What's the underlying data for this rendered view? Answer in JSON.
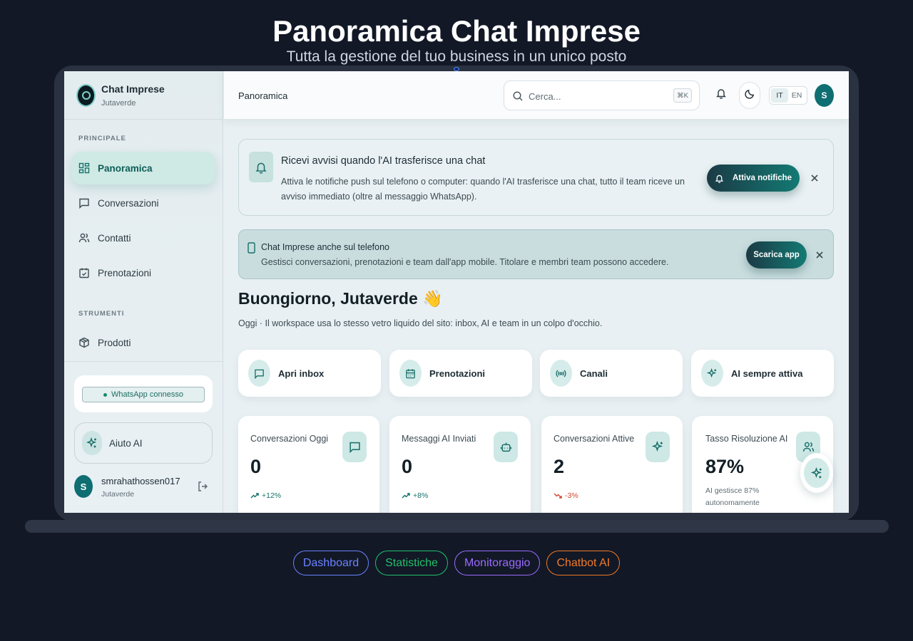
{
  "hero": {
    "title": "Panoramica Chat Imprese",
    "subtitle": "Tutta la gestione del tuo business in un unico posto"
  },
  "brand": {
    "name": "Chat Imprese",
    "workspace": "Jutaverde"
  },
  "sidebar": {
    "section_main": "PRINCIPALE",
    "section_tools": "STRUMENTI",
    "items": [
      {
        "label": "Panoramica",
        "icon": "grid-icon",
        "active": true
      },
      {
        "label": "Conversazioni",
        "icon": "chat-icon"
      },
      {
        "label": "Contatti",
        "icon": "users-icon"
      },
      {
        "label": "Prenotazioni",
        "icon": "calendar-check-icon"
      }
    ],
    "tools": [
      {
        "label": "Prodotti",
        "icon": "package-icon"
      }
    ],
    "whatsapp_status": "WhatsApp connesso",
    "help_label": "Aiuto AI",
    "user": {
      "name": "smrahathossen017",
      "workspace": "Jutaverde",
      "initial": "S"
    }
  },
  "topbar": {
    "breadcrumb": "Panoramica",
    "search_placeholder": "Cerca...",
    "shortcut": "⌘K",
    "lang": [
      "IT",
      "EN"
    ],
    "lang_active": "IT",
    "avatar_initial": "S"
  },
  "notice": {
    "title": "Ricevi avvisi quando l'AI trasferisce una chat",
    "desc": "Attiva le notifiche push sul telefono o computer: quando l'AI trasferisce una chat, tutto il team riceve un avviso immediato (oltre al messaggio WhatsApp).",
    "button": "Attiva notifiche"
  },
  "app_banner": {
    "title": "Chat Imprese anche sul telefono",
    "desc": "Gestisci conversazioni, prenotazioni e team dall'app mobile. Titolare e membri team possono accedere.",
    "button": "Scarica app"
  },
  "greeting": {
    "title": "Buongiorno, Jutaverde 👋",
    "subtitle": "Oggi · Il workspace usa lo stesso vetro liquido del sito: inbox, AI e team in un colpo d'occhio."
  },
  "quick_actions": [
    {
      "label": "Apri inbox",
      "icon": "chat-icon"
    },
    {
      "label": "Prenotazioni",
      "icon": "calendar-icon"
    },
    {
      "label": "Canali",
      "icon": "broadcast-icon"
    },
    {
      "label": "AI sempre attiva",
      "icon": "sparkles-icon"
    }
  ],
  "stats": [
    {
      "label": "Conversazioni Oggi",
      "value": "0",
      "trend": "+12%",
      "direction": "up",
      "icon": "chat-icon"
    },
    {
      "label": "Messaggi AI Inviati",
      "value": "0",
      "trend": "+8%",
      "direction": "up",
      "icon": "bot-icon"
    },
    {
      "label": "Conversazioni Attive",
      "value": "2",
      "trend": "-3%",
      "direction": "down",
      "icon": "sparkles-icon"
    },
    {
      "label": "Tasso Risoluzione AI",
      "value": "87%",
      "note": "AI gestisce 87% autonomamente",
      "icon": "users-icon"
    }
  ],
  "colors": {
    "accent": "#137269",
    "trend_up": "#137269",
    "trend_down": "#d2452b"
  },
  "tabs": [
    {
      "label": "Dashboard",
      "color": "#6b82ff"
    },
    {
      "label": "Statistiche",
      "color": "#22c06a"
    },
    {
      "label": "Monitoraggio",
      "color": "#9b6bff"
    },
    {
      "label": "Chatbot AI",
      "color": "#f07a2a"
    }
  ]
}
